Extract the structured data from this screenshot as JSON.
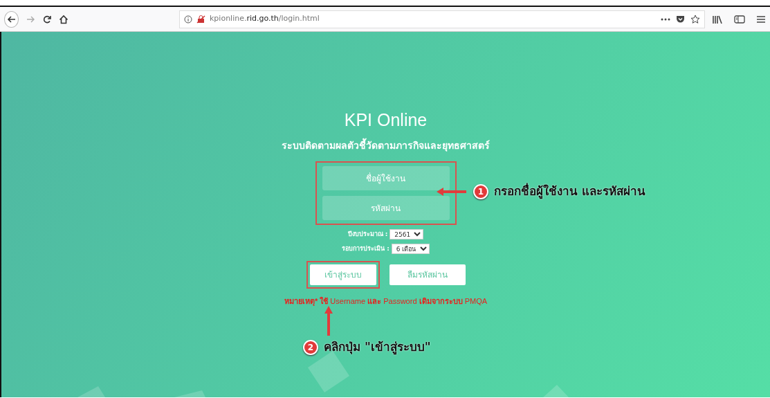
{
  "browser": {
    "url_host_prefix": "kpionline.",
    "url_host": "rid.go.th",
    "url_path": "/login.html"
  },
  "login": {
    "title": "KPI Online",
    "subtitle": "ระบบติดตามผลตัวชี้วัดตามภารกิจและยุทธศาสตร์",
    "fields": [
      {
        "placeholder": "ชื่อผู้ใช้งาน"
      },
      {
        "placeholder": "รหัสผ่าน"
      }
    ],
    "selects": [
      {
        "label": "ปีงบประมาณ :",
        "value": "2561"
      },
      {
        "label": "รอบการประเมิน :",
        "value": "6 เดือน"
      }
    ],
    "buttons": [
      {
        "label": "เข้าสู่ระบบ"
      },
      {
        "label": "ลืมรหัสผ่าน"
      }
    ],
    "note": "**หมายเหตุ* ใช้** Username **และ** Password **เดิมจากระบบ** PMQA"
  },
  "annotations": [
    {
      "number": "1",
      "text": "กรอกชื่อผู้ใช้งาน และรหัสผ่าน"
    },
    {
      "number": "2",
      "text": "คลิกปุ่ม \"เข้าสู่ระบบ\""
    }
  ]
}
